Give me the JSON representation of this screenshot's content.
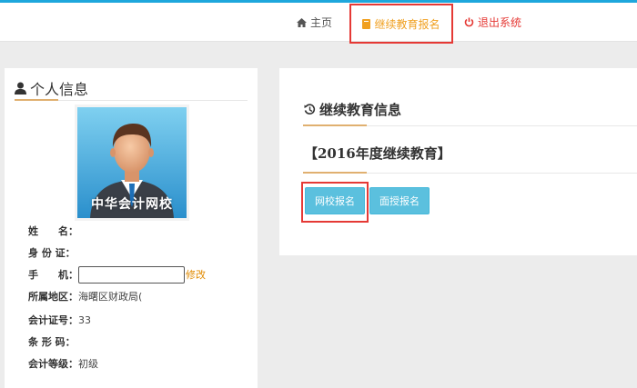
{
  "nav": {
    "home": "主页",
    "continuing_edu": "继续教育报名",
    "logout": "退出系统"
  },
  "profile": {
    "title": "个人信息",
    "avatar_caption": "中华会计网校",
    "name_label": "姓　　名：",
    "name_value": "",
    "id_label": "身 份 证：",
    "id_value": "",
    "phone_label": "手　　机：",
    "phone_value": "",
    "phone_edit": "修改",
    "region_label": "所属地区：",
    "region_value": "海曙区财政局(",
    "cert_label": "会计证号：",
    "cert_value": "33",
    "barcode_label": "条 形 码：",
    "barcode_value": "",
    "level_label": "会计等级：",
    "level_value": "初级"
  },
  "education": {
    "title": "继续教育信息",
    "course": "【2016年度继续教育】",
    "online_button": "网校报名",
    "face_button": "面授报名"
  },
  "colors": {
    "accent_blue": "#1ea7dc",
    "button_blue": "#5bc0de",
    "highlight_red": "#e53935",
    "link_orange": "#e08a00",
    "nav_orange": "#f0a020"
  },
  "icons": {
    "home": "home-icon",
    "book": "book-icon",
    "power": "power-icon",
    "user": "user-icon",
    "history": "history-icon"
  }
}
